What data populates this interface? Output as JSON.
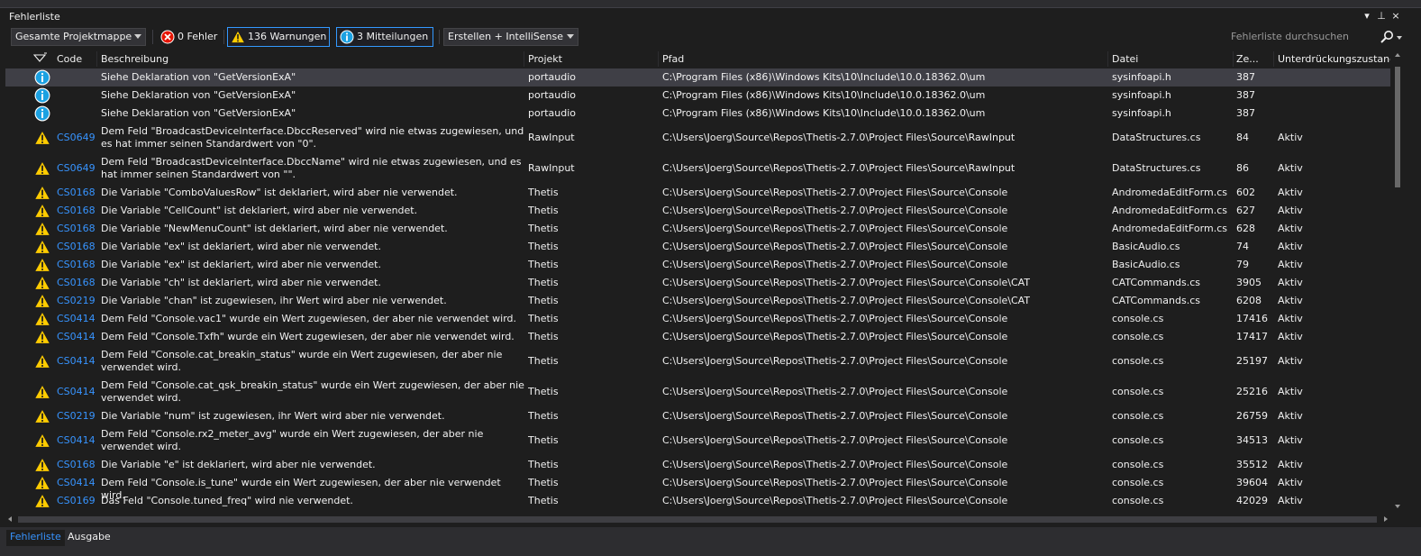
{
  "window": {
    "title": "Fehlerliste"
  },
  "titlebar_buttons": {
    "dropdown": "▾",
    "pin": "⊥",
    "close": "×"
  },
  "toolbar": {
    "scope_combo": "Gesamte Projektmappe",
    "errors_button": "0 Fehler",
    "warnings_button": "136 Warnungen",
    "messages_button": "3 Mitteilungen",
    "build_combo": "Erstellen + IntelliSense",
    "search_placeholder": "Fehlerliste durchsuchen"
  },
  "columns": {
    "code": "Code",
    "description": "Beschreibung",
    "project": "Projekt",
    "path": "Pfad",
    "file": "Datei",
    "line": "Ze...",
    "suppression": "Unterdrückungszustand"
  },
  "colors": {
    "accent": "#3399ff",
    "warning": "#ffcc00",
    "info": "#1ba1e2",
    "error": "#e51400",
    "selected_row": "#3f3f46"
  },
  "rows": [
    {
      "severity": "info",
      "code": "",
      "description": "Siehe Deklaration von \"GetVersionExA\"",
      "project": "portaudio",
      "path": "C:\\Program Files (x86)\\Windows Kits\\10\\Include\\10.0.18362.0\\um",
      "file": "sysinfoapi.h",
      "line": "387",
      "suppression": ""
    },
    {
      "severity": "info",
      "code": "",
      "description": "Siehe Deklaration von \"GetVersionExA\"",
      "project": "portaudio",
      "path": "C:\\Program Files (x86)\\Windows Kits\\10\\Include\\10.0.18362.0\\um",
      "file": "sysinfoapi.h",
      "line": "387",
      "suppression": ""
    },
    {
      "severity": "info",
      "code": "",
      "description": "Siehe Deklaration von \"GetVersionExA\"",
      "project": "portaudio",
      "path": "C:\\Program Files (x86)\\Windows Kits\\10\\Include\\10.0.18362.0\\um",
      "file": "sysinfoapi.h",
      "line": "387",
      "suppression": ""
    },
    {
      "severity": "warning",
      "code": "CS0649",
      "description": "Dem Feld \"BroadcastDeviceInterface.DbccReserved\" wird nie etwas zugewiesen, und es hat immer seinen Standardwert von \"0\".",
      "project": "RawInput",
      "path": "C:\\Users\\Joerg\\Source\\Repos\\Thetis-2.7.0\\Project Files\\Source\\RawInput",
      "file": "DataStructures.cs",
      "line": "84",
      "suppression": "Aktiv"
    },
    {
      "severity": "warning",
      "code": "CS0649",
      "description": "Dem Feld \"BroadcastDeviceInterface.DbccName\" wird nie etwas zugewiesen, und es hat immer seinen Standardwert von \"\".",
      "project": "RawInput",
      "path": "C:\\Users\\Joerg\\Source\\Repos\\Thetis-2.7.0\\Project Files\\Source\\RawInput",
      "file": "DataStructures.cs",
      "line": "86",
      "suppression": "Aktiv"
    },
    {
      "severity": "warning",
      "code": "CS0168",
      "description": "Die Variable \"ComboValuesRow\" ist deklariert, wird aber nie verwendet.",
      "project": "Thetis",
      "path": "C:\\Users\\Joerg\\Source\\Repos\\Thetis-2.7.0\\Project Files\\Source\\Console",
      "file": "AndromedaEditForm.cs",
      "line": "602",
      "suppression": "Aktiv"
    },
    {
      "severity": "warning",
      "code": "CS0168",
      "description": "Die Variable \"CellCount\" ist deklariert, wird aber nie verwendet.",
      "project": "Thetis",
      "path": "C:\\Users\\Joerg\\Source\\Repos\\Thetis-2.7.0\\Project Files\\Source\\Console",
      "file": "AndromedaEditForm.cs",
      "line": "627",
      "suppression": "Aktiv"
    },
    {
      "severity": "warning",
      "code": "CS0168",
      "description": "Die Variable \"NewMenuCount\" ist deklariert, wird aber nie verwendet.",
      "project": "Thetis",
      "path": "C:\\Users\\Joerg\\Source\\Repos\\Thetis-2.7.0\\Project Files\\Source\\Console",
      "file": "AndromedaEditForm.cs",
      "line": "628",
      "suppression": "Aktiv"
    },
    {
      "severity": "warning",
      "code": "CS0168",
      "description": "Die Variable \"ex\" ist deklariert, wird aber nie verwendet.",
      "project": "Thetis",
      "path": "C:\\Users\\Joerg\\Source\\Repos\\Thetis-2.7.0\\Project Files\\Source\\Console",
      "file": "BasicAudio.cs",
      "line": "74",
      "suppression": "Aktiv"
    },
    {
      "severity": "warning",
      "code": "CS0168",
      "description": "Die Variable \"ex\" ist deklariert, wird aber nie verwendet.",
      "project": "Thetis",
      "path": "C:\\Users\\Joerg\\Source\\Repos\\Thetis-2.7.0\\Project Files\\Source\\Console",
      "file": "BasicAudio.cs",
      "line": "79",
      "suppression": "Aktiv"
    },
    {
      "severity": "warning",
      "code": "CS0168",
      "description": "Die Variable \"ch\" ist deklariert, wird aber nie verwendet.",
      "project": "Thetis",
      "path": "C:\\Users\\Joerg\\Source\\Repos\\Thetis-2.7.0\\Project Files\\Source\\Console\\CAT",
      "file": "CATCommands.cs",
      "line": "3905",
      "suppression": "Aktiv"
    },
    {
      "severity": "warning",
      "code": "CS0219",
      "description": "Die Variable \"chan\" ist zugewiesen, ihr Wert wird aber nie verwendet.",
      "project": "Thetis",
      "path": "C:\\Users\\Joerg\\Source\\Repos\\Thetis-2.7.0\\Project Files\\Source\\Console\\CAT",
      "file": "CATCommands.cs",
      "line": "6208",
      "suppression": "Aktiv"
    },
    {
      "severity": "warning",
      "code": "CS0414",
      "description": "Dem Feld \"Console.vac1\" wurde ein Wert zugewiesen, der aber nie verwendet wird.",
      "project": "Thetis",
      "path": "C:\\Users\\Joerg\\Source\\Repos\\Thetis-2.7.0\\Project Files\\Source\\Console",
      "file": "console.cs",
      "line": "17416",
      "suppression": "Aktiv"
    },
    {
      "severity": "warning",
      "code": "CS0414",
      "description": "Dem Feld \"Console.Txfh\" wurde ein Wert zugewiesen, der aber nie verwendet wird.",
      "project": "Thetis",
      "path": "C:\\Users\\Joerg\\Source\\Repos\\Thetis-2.7.0\\Project Files\\Source\\Console",
      "file": "console.cs",
      "line": "17417",
      "suppression": "Aktiv"
    },
    {
      "severity": "warning",
      "code": "CS0414",
      "description": "Dem Feld \"Console.cat_breakin_status\" wurde ein Wert zugewiesen, der aber nie verwendet wird.",
      "project": "Thetis",
      "path": "C:\\Users\\Joerg\\Source\\Repos\\Thetis-2.7.0\\Project Files\\Source\\Console",
      "file": "console.cs",
      "line": "25197",
      "suppression": "Aktiv"
    },
    {
      "severity": "warning",
      "code": "CS0414",
      "description": "Dem Feld \"Console.cat_qsk_breakin_status\" wurde ein Wert zugewiesen, der aber nie verwendet wird.",
      "project": "Thetis",
      "path": "C:\\Users\\Joerg\\Source\\Repos\\Thetis-2.7.0\\Project Files\\Source\\Console",
      "file": "console.cs",
      "line": "25216",
      "suppression": "Aktiv"
    },
    {
      "severity": "warning",
      "code": "CS0219",
      "description": "Die Variable \"num\" ist zugewiesen, ihr Wert wird aber nie verwendet.",
      "project": "Thetis",
      "path": "C:\\Users\\Joerg\\Source\\Repos\\Thetis-2.7.0\\Project Files\\Source\\Console",
      "file": "console.cs",
      "line": "26759",
      "suppression": "Aktiv"
    },
    {
      "severity": "warning",
      "code": "CS0414",
      "description": "Dem Feld \"Console.rx2_meter_avg\" wurde ein Wert zugewiesen, der aber nie verwendet wird.",
      "project": "Thetis",
      "path": "C:\\Users\\Joerg\\Source\\Repos\\Thetis-2.7.0\\Project Files\\Source\\Console",
      "file": "console.cs",
      "line": "34513",
      "suppression": "Aktiv"
    },
    {
      "severity": "warning",
      "code": "CS0168",
      "description": "Die Variable \"e\" ist deklariert, wird aber nie verwendet.",
      "project": "Thetis",
      "path": "C:\\Users\\Joerg\\Source\\Repos\\Thetis-2.7.0\\Project Files\\Source\\Console",
      "file": "console.cs",
      "line": "35512",
      "suppression": "Aktiv"
    },
    {
      "severity": "warning",
      "code": "CS0414",
      "description": "Dem Feld \"Console.is_tune\" wurde ein Wert zugewiesen, der aber nie verwendet wird.",
      "project": "Thetis",
      "path": "C:\\Users\\Joerg\\Source\\Repos\\Thetis-2.7.0\\Project Files\\Source\\Console",
      "file": "console.cs",
      "line": "39604",
      "suppression": "Aktiv"
    },
    {
      "severity": "warning",
      "code": "CS0169",
      "description": "Das Feld \"Console.tuned_freq\" wird nie verwendet.",
      "project": "Thetis",
      "path": "C:\\Users\\Joerg\\Source\\Repos\\Thetis-2.7.0\\Project Files\\Source\\Console",
      "file": "console.cs",
      "line": "42029",
      "suppression": "Aktiv"
    }
  ],
  "bottom_tabs": [
    "Fehlerliste",
    "Ausgabe"
  ]
}
